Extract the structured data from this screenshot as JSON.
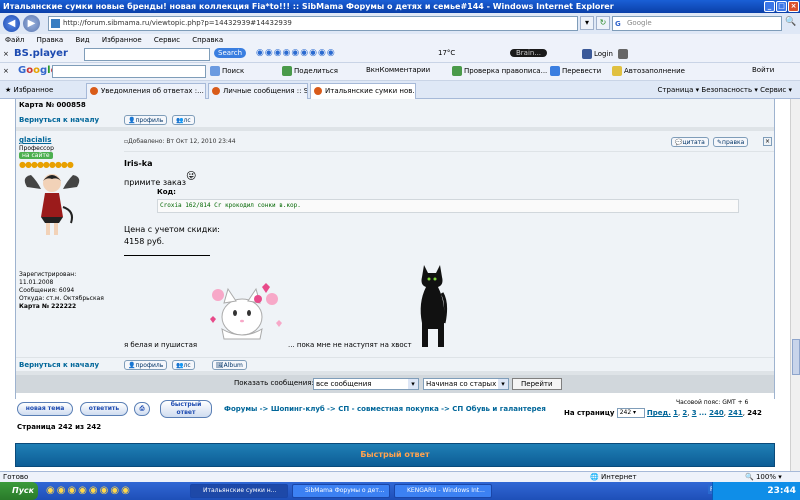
{
  "window": {
    "title": "Итальянские сумки новые бренды! новая коллекция Fia*to!!! :: SibMama Форумы о детях и семье#144 - Windows Internet Explorer"
  },
  "address": {
    "url": "http://forum.sibmama.ru/viewtopic.php?p=14432939#14432939",
    "search_placeholder": "Google"
  },
  "menu": [
    "Файл",
    "Правка",
    "Вид",
    "Избранное",
    "Сервис",
    "Справка"
  ],
  "toolbar1": {
    "player": "BS.player",
    "search_label": "Search",
    "temperature": "17°C",
    "login": "Login",
    "brain": "Brain..."
  },
  "toolbar2": {
    "logo": "Google",
    "items": [
      "Поиск",
      "Поделиться",
      "ВкнКомментарии",
      "Проверка правописа...",
      "Перевести",
      "Автозаполнение",
      "Войти"
    ]
  },
  "tabs": {
    "favorites": "Избранное",
    "items": [
      "Уведомления об ответах :...",
      "Личные сообщения :: SibM...",
      "Итальянские сумки нов..."
    ],
    "commands": "Страница ▾  Безопасность ▾  Сервис ▾"
  },
  "post_prev": {
    "card": "Карта № 000858",
    "back_link": "Вернуться к началу",
    "profile_btn": "профиль",
    "pm_btn": "лс"
  },
  "post": {
    "author": "glacialis",
    "rank": "Профессор",
    "online": "на сайте",
    "registered_label": "Зарегистрирован:",
    "registered": "11.01.2008",
    "messages": "Сообщения: 6094",
    "from": "Откуда: ст.м. Октябрьская",
    "card": "Карта № 222222",
    "added": "Добавлено: Вт Окт 12, 2010 23:44",
    "quote_btn": "цитата",
    "edit_btn": "правка",
    "greeting": "Iris-ka",
    "line1": "примите заказ",
    "code_label": "Код:",
    "code": "Croxia 162/814 Cr крокодил сонки в.кор.",
    "price_label": "Цена с учетом скидки:",
    "price": "4158 руб.",
    "line_cat": "я белая и пушистая",
    "line_dog": "... пока мне не наступят на хвост",
    "back_link": "Вернуться к началу",
    "profile_btn": "профиль",
    "pm_btn": "лс",
    "album_btn": "Album"
  },
  "filter": {
    "show_label": "Показать сообщения:",
    "show_value": "все сообщения",
    "order_value": "Начиная со старых",
    "go_btn": "Перейти"
  },
  "bottom": {
    "new_topic": "новая тема",
    "reply": "ответить",
    "quick_reply": "быстрый ответ",
    "timezone": "Часовой пояс: GMT + 6",
    "breadcrumb": [
      "Форумы",
      "Шопинг-клуб",
      "СП - совместная покупка",
      "СП Обувь и галантерея"
    ],
    "page_label": "На страницу",
    "page_value": "242",
    "pages_prev": "Пред.",
    "pages": [
      "1",
      "2",
      "3",
      "...",
      "240",
      "241"
    ],
    "current_page": "242",
    "page_count": "Страница 242 из 242",
    "quick_reply_bar": "Быстрый ответ"
  },
  "status": {
    "text": "Готово",
    "zone": "Интернет",
    "zoom": "100%"
  },
  "taskbar": {
    "start": "Пуск",
    "items": [
      "Итальянские сумки н...",
      "SibMama Форумы о дет...",
      "KENGARU - Windows Int..."
    ],
    "lang": "RU",
    "clock": "23:44"
  }
}
